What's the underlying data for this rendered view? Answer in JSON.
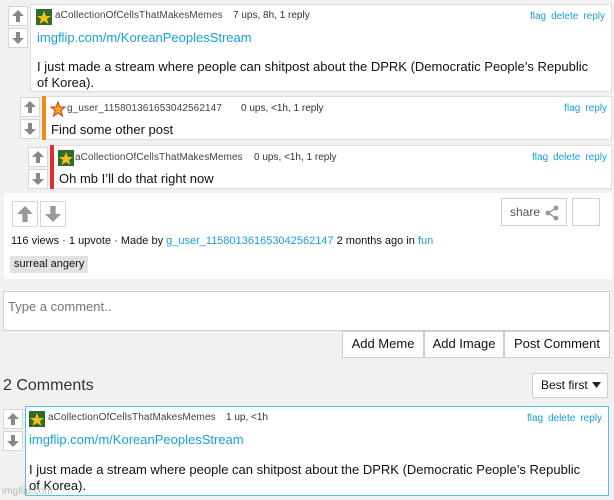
{
  "comments": [
    {
      "user": "aCollectionOfCellsThatMakesMemes",
      "meta": "7 ups, 8h, 1 reply",
      "actions": [
        "flag",
        "delete",
        "reply"
      ],
      "link": "imgflip.com/m/KoreanPeoplesStream",
      "text": "I just made a stream where people can shitpost about the DPRK (Democratic People’s Republic of Korea)."
    },
    {
      "user": "g_user_115801361653042562147",
      "meta": "0 ups, <1h, 1 reply",
      "actions": [
        "flag",
        "reply"
      ],
      "text": "Find some other post",
      "bar_color": "#f08a1c"
    },
    {
      "user": "aCollectionOfCellsThatMakesMemes",
      "meta": "0 ups, <1h, 1 reply",
      "actions": [
        "flag",
        "delete",
        "reply"
      ],
      "text": "Oh mb I’ll do that right now",
      "bar_color": "#e0302d"
    }
  ],
  "post_footer": {
    "share_label": "share",
    "views": "116 views",
    "upvotes": "1 upvote",
    "made_by_label": "Made by",
    "made_by_user": "g_user_115801361653042562147",
    "time": "2 months ago in",
    "stream": "fun",
    "tag": "surreal angery"
  },
  "comment_box": {
    "placeholder": "Type a comment..",
    "add_meme": "Add Meme",
    "add_image": "Add Image",
    "post_comment": "Post Comment"
  },
  "comments_section": {
    "count_label": "2 Comments",
    "sort_label": "Best first"
  },
  "bottom_comment": {
    "user": "aCollectionOfCellsThatMakesMemes",
    "meta": "1 up, <1h",
    "actions": [
      "flag",
      "delete",
      "reply"
    ],
    "link": "imgflip.com/m/KoreanPeoplesStream",
    "text": "I just made a stream where people can shitpost about the DPRK (Democratic People’s Republic of Korea)."
  },
  "watermark": "imgflip.com",
  "colors": {
    "link": "#1aa0d8",
    "highlight_border": "#4fc0e6",
    "reply_bar_1": "#f08a1c",
    "reply_bar_2": "#e0302d"
  },
  "icons": [
    "upvote-arrow-icon",
    "downvote-arrow-icon",
    "share-icon",
    "caret-down-icon",
    "user-avatar-icon",
    "star-icon"
  ]
}
